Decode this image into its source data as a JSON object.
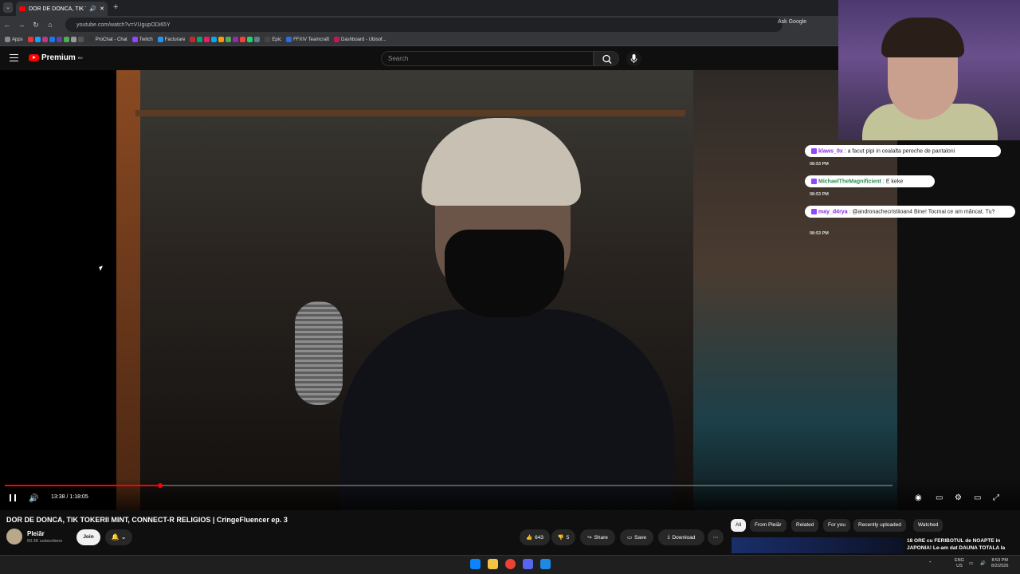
{
  "browser": {
    "tab_title": "DOR DE DONCA, TIK TOKE",
    "url": "youtube.com/watch?v=VUgupODi65Y",
    "ask_google": "Ask Google",
    "bookmarks": [
      "Apps",
      "ProChat - Chat",
      "Twitch",
      "Facturare",
      "Epic",
      "FFXIV Teamcraft",
      "Dashboard - Ubisof..."
    ]
  },
  "youtube": {
    "logo_text": "Premium",
    "logo_sup": "RO",
    "search_placeholder": "Search"
  },
  "player": {
    "time": "13:38 / 1:18:05",
    "progress_fraction": 0.175
  },
  "chat": {
    "messages": [
      {
        "user": "klaws_0x",
        "text": "a facut pipi in cealalta pereche de pantaloni",
        "time": "08:53 PM",
        "color": "#8a2be2"
      },
      {
        "user": "MichaelTheMagnificient",
        "text": "E keke",
        "time": "08:53 PM",
        "color": "#2e8b57"
      },
      {
        "user": "may_d4rya",
        "text": "@andronachecristiioan4 Bine! Tocmai ce am mâncat. Tu?",
        "time": "08:53 PM",
        "color": "#8a2be2"
      }
    ]
  },
  "video": {
    "title": "DOR DE DONCA, TIK TOKERII MINT, CONNECT-R RELIGIOS | CringeFluencer ep. 3",
    "channel": "Pleiăr",
    "subscribers": "50.3K subscribers",
    "join_label": "Join",
    "likes": "643",
    "dislikes": "5",
    "share_label": "Share",
    "save_label": "Save",
    "download_label": "Download"
  },
  "chips": [
    "All",
    "From Pleiăr",
    "Related",
    "For you",
    "Recently uploaded",
    "Watched"
  ],
  "recommendation": {
    "title": "18 ORE cu FERIBOTUL de NOAPTE in JAPONIA! Le-am dat DAUNA TOTALA la"
  },
  "taskbar": {
    "lang_top": "ENG",
    "lang_bottom": "US",
    "clock": "8:53 PM",
    "date": "8/2/2026"
  },
  "colors": {
    "accent": "#ff0000",
    "twitch": "#9146ff"
  }
}
